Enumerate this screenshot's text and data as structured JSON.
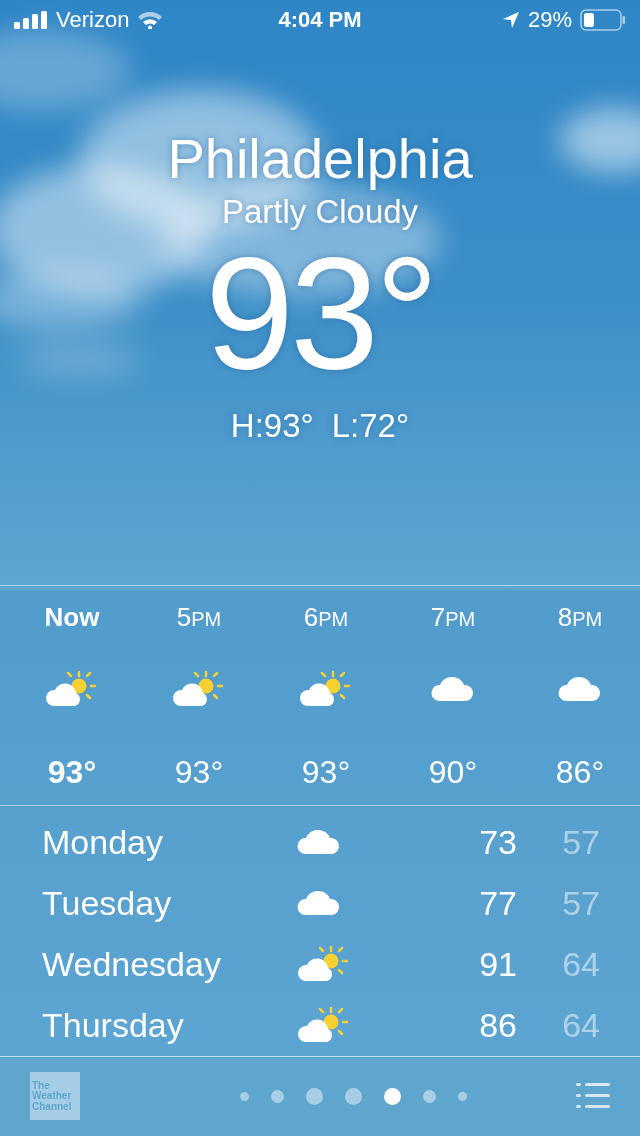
{
  "status_bar": {
    "carrier": "Verizon",
    "time": "4:04 PM",
    "battery": "29%",
    "location_on": true
  },
  "header": {
    "city": "Philadelphia",
    "condition": "Partly Cloudy",
    "temperature": "93°",
    "high": "H:93°",
    "low": "L:72°"
  },
  "hourly": [
    {
      "time": "Now",
      "kind": "partly-sunny",
      "temp": "93°",
      "selected": true
    },
    {
      "time": "5",
      "meridiem": "PM",
      "kind": "partly-sunny",
      "temp": "93°",
      "selected": false
    },
    {
      "time": "6",
      "meridiem": "PM",
      "kind": "partly-sunny",
      "temp": "93°",
      "selected": false
    },
    {
      "time": "7",
      "meridiem": "PM",
      "kind": "cloudy",
      "temp": "90°",
      "selected": false
    },
    {
      "time": "8",
      "meridiem": "PM",
      "kind": "cloudy",
      "temp": "86°",
      "selected": false
    }
  ],
  "daily": [
    {
      "day": "Monday",
      "kind": "cloudy",
      "high": "73",
      "low": "57"
    },
    {
      "day": "Tuesday",
      "kind": "cloudy",
      "high": "77",
      "low": "57"
    },
    {
      "day": "Wednesday",
      "kind": "partly-sunny",
      "high": "91",
      "low": "64"
    },
    {
      "day": "Thursday",
      "kind": "partly-sunny",
      "high": "86",
      "low": "64"
    }
  ],
  "footer": {
    "logo": [
      "The",
      "Weather",
      "Channel"
    ],
    "pages": [
      {
        "selected": false
      },
      {
        "selected": false
      },
      {
        "selected": false
      },
      {
        "selected": false
      },
      {
        "selected": true
      },
      {
        "selected": false
      },
      {
        "selected": false
      }
    ]
  }
}
